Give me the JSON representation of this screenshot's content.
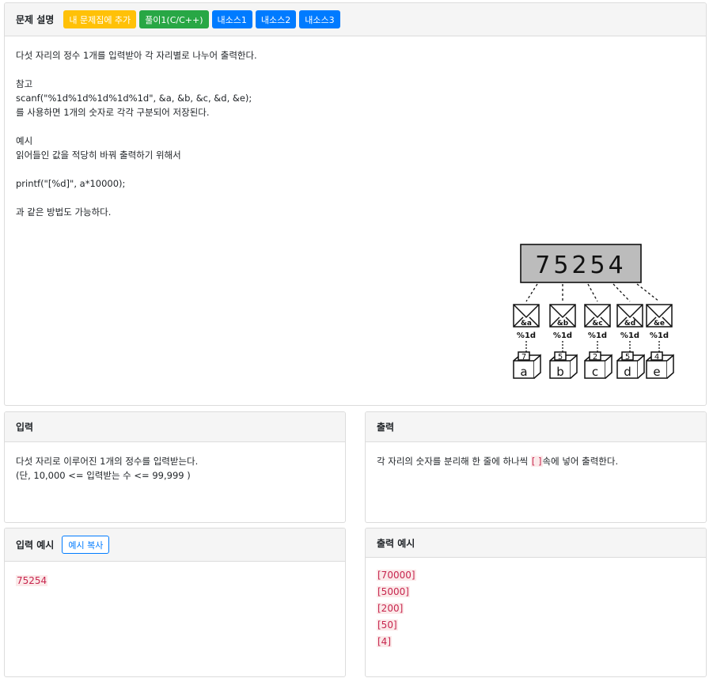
{
  "problem": {
    "title": "문제 설명",
    "buttons": {
      "add_to_set": "내 문제집에 추가",
      "solution": "풀이1(C/C++)",
      "source1": "내소스1",
      "source2": "내소스2",
      "source3": "내소스3"
    },
    "body": {
      "line1": "다섯 자리의 정수 1개를 입력받아 각 자리별로 나누어 출력한다.",
      "line2": "참고",
      "line3": "scanf(\"%1d%1d%1d%1d%1d\", &a, &b, &c, &d, &e);",
      "line4": "를 사용하면 1개의 숫자로 각각 구분되어 저장된다.",
      "line5": "예시",
      "line6": "읽어들인 값을 적당히 바꿔 출력하기 위해서",
      "line7": "printf(\"[%d]\", a*10000);",
      "line8": "과 같은 방법도 가능하다."
    },
    "diagram": {
      "number": "75254",
      "pointers": [
        "&a",
        "&b",
        "&c",
        "&d",
        "&e"
      ],
      "format": "%1d",
      "digits": [
        "7",
        "5",
        "2",
        "5",
        "4"
      ],
      "vars": [
        "a",
        "b",
        "c",
        "d",
        "e"
      ]
    }
  },
  "input": {
    "title": "입력",
    "line1": "다섯 자리로 이루어진 1개의 정수를 입력받는다.",
    "line2": "(단, 10,000 <= 입력받는 수 <= 99,999 )"
  },
  "output": {
    "title": "출력",
    "text_before": "각 자리의 숫자를 분리해 한 줄에 하나씩 ",
    "bracket": "[ ]",
    "text_after": "속에 넣어 출력한다."
  },
  "sample_input": {
    "title": "입력 예시",
    "copy_button": "예시 복사",
    "value": "75254"
  },
  "sample_output": {
    "title": "출력 예시",
    "lines": [
      "[70000]",
      "[5000]",
      "[200]",
      "[50]",
      "[4]"
    ]
  }
}
